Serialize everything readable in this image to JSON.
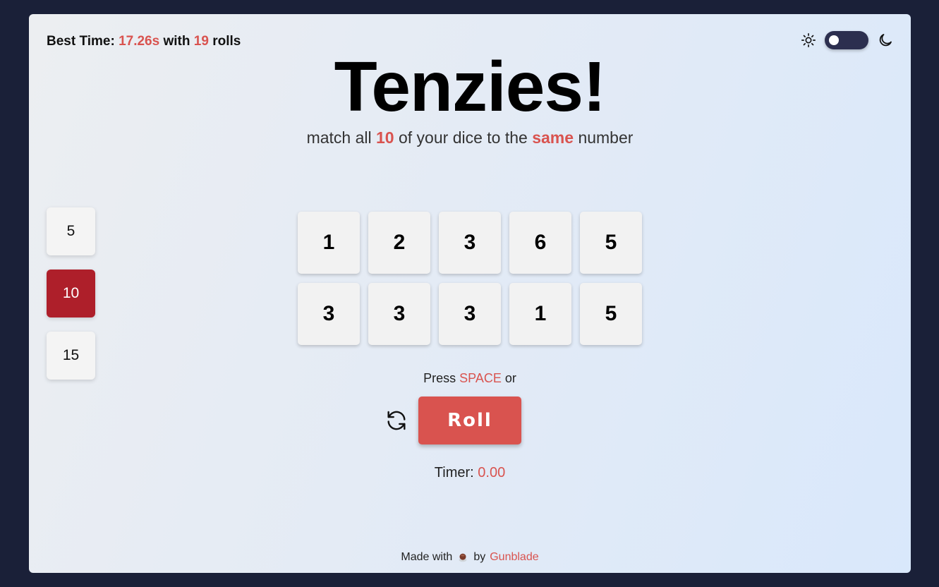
{
  "best_time": {
    "label": "Best Time:",
    "time": "17.26s",
    "with_label": "with",
    "rolls": "19",
    "rolls_label": "rolls"
  },
  "theme": {
    "sun_icon": "sun-icon",
    "moon_icon": "moon-icon",
    "dark_mode": false
  },
  "title": "Tenzies!",
  "subtitle": {
    "part1": "match all",
    "count": "10",
    "part2": "of your dice to the",
    "emph": "same",
    "part3": "number"
  },
  "modes": [
    {
      "label": "5",
      "active": false
    },
    {
      "label": "10",
      "active": true
    },
    {
      "label": "15",
      "active": false
    }
  ],
  "dice": [
    "1",
    "2",
    "3",
    "6",
    "5",
    "3",
    "3",
    "3",
    "1",
    "5"
  ],
  "press_hint": {
    "prefix": "Press",
    "key": "SPACE",
    "suffix": "or"
  },
  "roll_label": "Roll",
  "timer": {
    "label": "Timer:",
    "value": "0.00"
  },
  "footer": {
    "made_with": "Made with",
    "by": "by",
    "author": "Gunblade"
  },
  "colors": {
    "accent": "#d9534f",
    "active_mode": "#ae1f2a",
    "background": "#1a2038"
  }
}
